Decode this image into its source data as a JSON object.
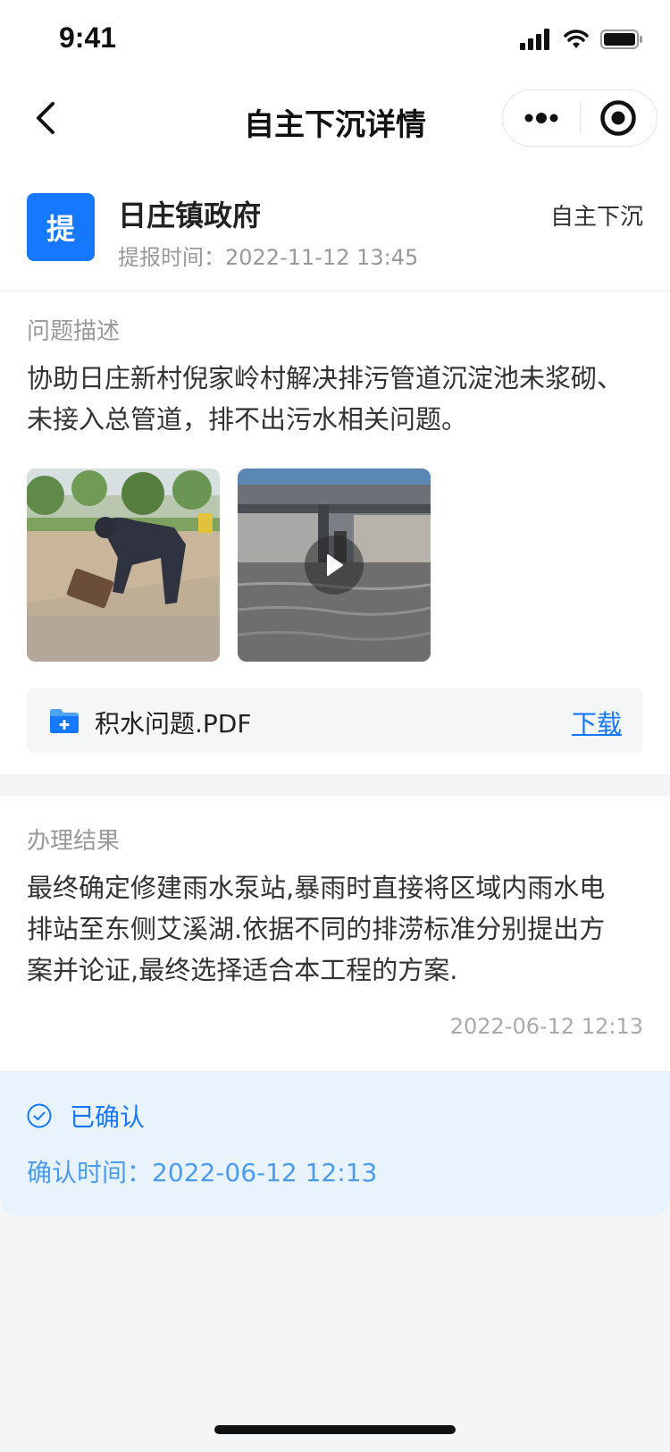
{
  "status_bar": {
    "time": "9:41"
  },
  "nav": {
    "title": "自主下沉详情"
  },
  "header": {
    "avatar_char": "提",
    "org_name": "日庄镇政府",
    "submit_time_label": "提报时间：",
    "submit_time": "2022-11-12 13:45",
    "type": "自主下沉"
  },
  "problem": {
    "section_title": "问题描述",
    "line1": "协助日庄新村倪家岭村解决排污管道沉淀池未浆砌、",
    "line2": "未接入总管道，排不出污水相关问题。",
    "attachment": {
      "file_name": "积水问题.PDF",
      "download_label": "下载"
    }
  },
  "result": {
    "section_title": "办理结果",
    "line1": "最终确定修建雨水泵站,暴雨时直接将区域内雨水电",
    "line2": "排站至东侧艾溪湖.依据不同的排涝标准分别提出方",
    "line3": "案并论证,最终选择适合本工程的方案.",
    "time": "2022-06-12 12:13"
  },
  "confirmation": {
    "status": "已确认",
    "time_label": "确认时间：",
    "time": "2022-06-12 12:13"
  },
  "colors": {
    "accent": "#1677ff",
    "confirm_bg": "#e9f3fd"
  }
}
